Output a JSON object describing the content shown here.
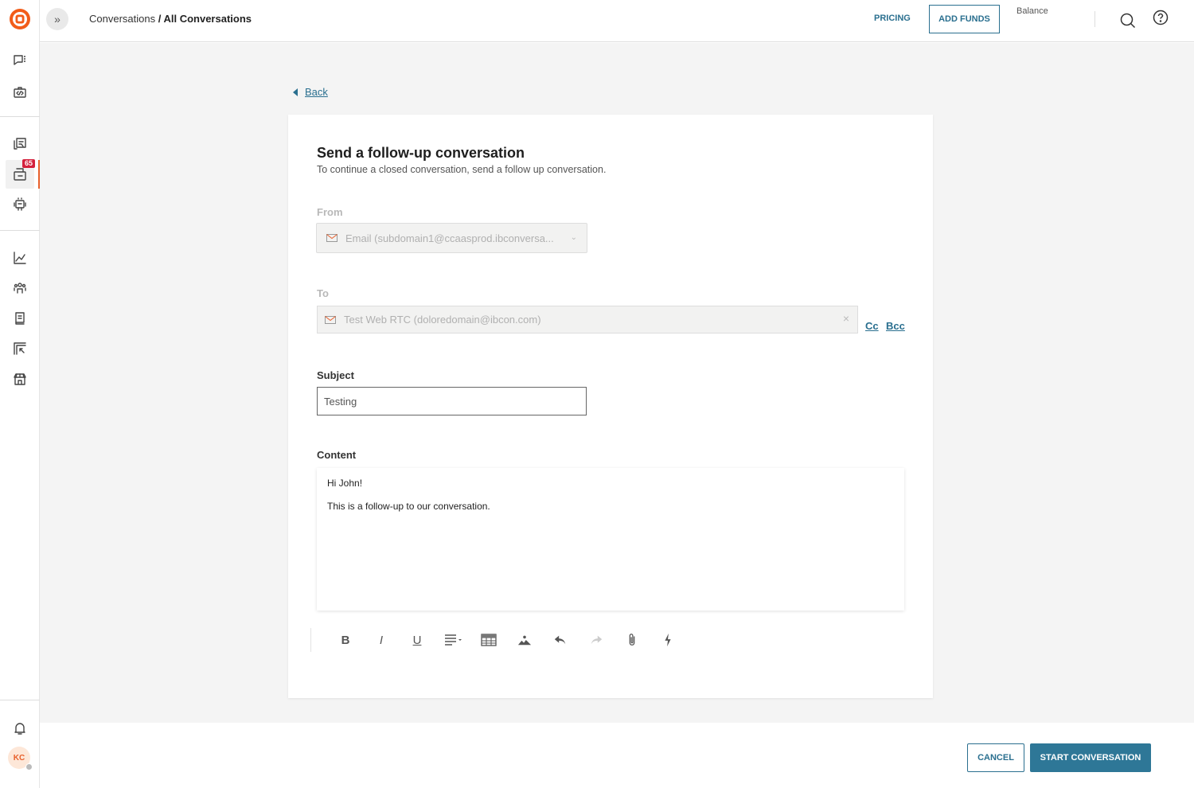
{
  "header": {
    "breadcrumb_parent": "Conversations",
    "breadcrumb_separator": " / ",
    "breadcrumb_current": "All Conversations",
    "pricing_label": "PRICING",
    "add_funds_label": "ADD FUNDS",
    "balance_label": "Balance"
  },
  "sidebar": {
    "items": [
      {
        "icon": "chat-list-icon"
      },
      {
        "icon": "code-briefcase-icon"
      },
      {
        "icon": "conversations-copy-icon"
      },
      {
        "icon": "inbox-icon",
        "badge": "65",
        "active": true
      },
      {
        "icon": "robot-icon"
      },
      {
        "icon": "analytics-chart-icon"
      },
      {
        "icon": "people-group-icon"
      },
      {
        "icon": "book-icon"
      },
      {
        "icon": "frame-arrow-icon"
      },
      {
        "icon": "store-icon"
      }
    ],
    "avatar_initials": "KC",
    "accent_color": "#e8602c"
  },
  "page": {
    "back_label": "Back",
    "title": "Send a follow-up conversation",
    "subtitle": "To continue a closed conversation, send a follow up conversation.",
    "from": {
      "label": "From",
      "value": "Email (subdomain1@ccaasprod.ibconversa..."
    },
    "to": {
      "label": "To",
      "value": "Test Web RTC (doloredomain@ibcon.com)",
      "cc_label": "Cc",
      "bcc_label": "Bcc"
    },
    "subject": {
      "label": "Subject",
      "value": "Testing"
    },
    "content": {
      "label": "Content",
      "lines": [
        "Hi John!",
        "This is a follow-up to our conversation."
      ]
    },
    "toolbar": [
      "bold",
      "italic",
      "underline",
      "align",
      "table",
      "image",
      "undo",
      "redo",
      "attachment",
      "quick-action"
    ]
  },
  "footer": {
    "cancel_label": "CANCEL",
    "start_label": "START CONVERSATION"
  },
  "colors": {
    "primary": "#2e7797",
    "link": "#2a6f8f",
    "badge": "#d4213d"
  }
}
